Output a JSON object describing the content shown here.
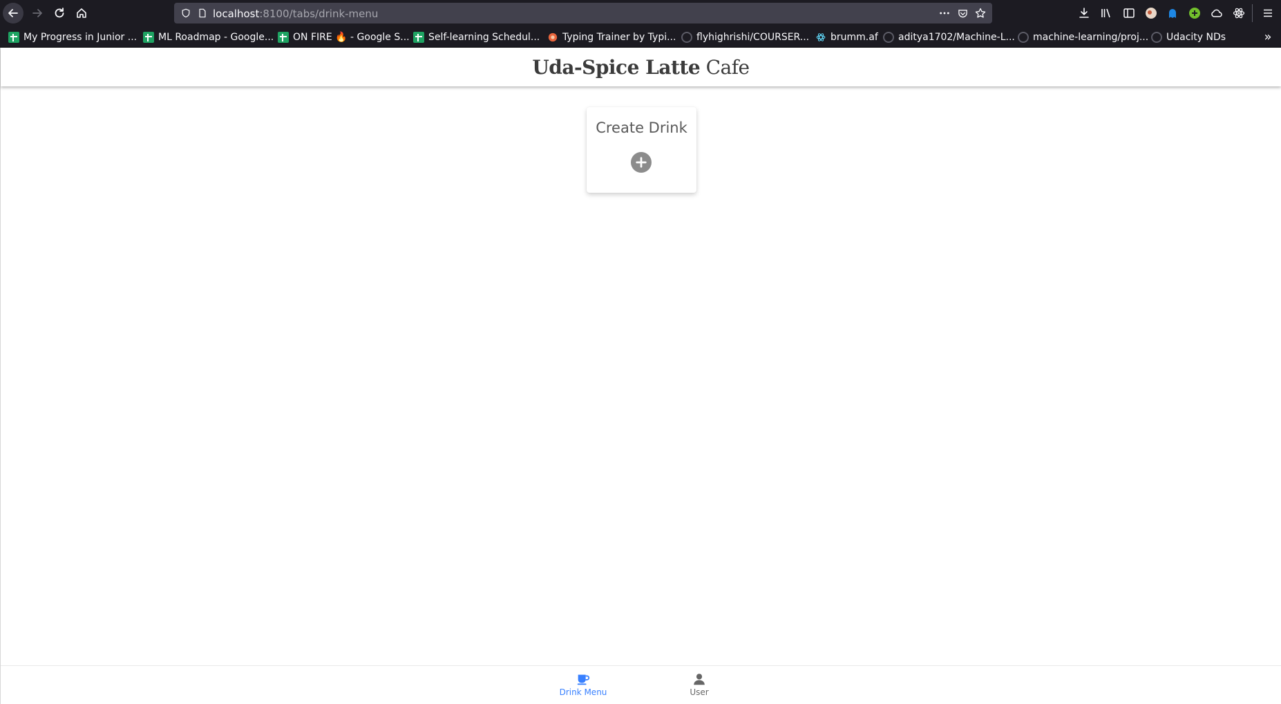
{
  "browser": {
    "url_host": "localhost",
    "url_rest": ":8100/tabs/drink-menu",
    "bookmarks": [
      {
        "label": "My Progress in Junior ...",
        "icon": "sheets-icon"
      },
      {
        "label": "ML Roadmap - Google...",
        "icon": "sheets-icon"
      },
      {
        "label": "ON FIRE 🔥 - Google S...",
        "icon": "sheets-icon"
      },
      {
        "label": "Self-learning Schedul...",
        "icon": "sheets-icon"
      },
      {
        "label": "Typing Trainer by Typi...",
        "icon": "typing-icon"
      },
      {
        "label": "flyhighrishi/COURSER...",
        "icon": "github-icon"
      },
      {
        "label": "brumm.af",
        "icon": "react-icon"
      },
      {
        "label": "aditya1702/Machine-L...",
        "icon": "github-icon"
      },
      {
        "label": "machine-learning/proj...",
        "icon": "github-icon"
      },
      {
        "label": "Udacity NDs",
        "icon": "github-icon"
      }
    ]
  },
  "app": {
    "title_bold": "Uda-Spice Latte",
    "title_light": "Cafe"
  },
  "create_card": {
    "title": "Create Drink",
    "icon": "add-circle-icon"
  },
  "tabs": [
    {
      "label": "Drink Menu",
      "icon": "cafe-icon",
      "selected": true,
      "color": "#3880ff"
    },
    {
      "label": "User",
      "icon": "person-icon",
      "selected": false,
      "color": "#666666"
    }
  ]
}
